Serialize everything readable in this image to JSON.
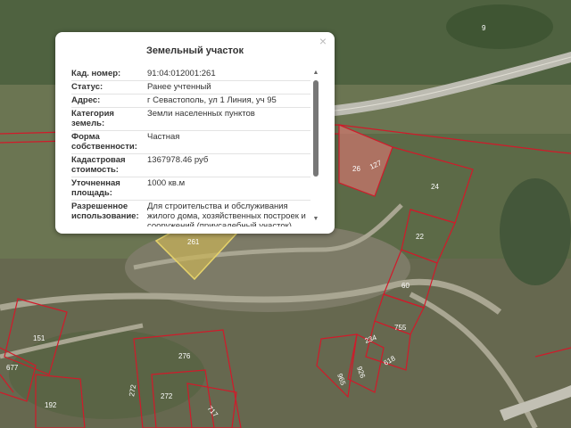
{
  "popup": {
    "title": "Земельный участок",
    "close_glyph": "×",
    "rows": [
      {
        "key": "Кад. номер:",
        "value": "91:04:012001:261"
      },
      {
        "key": "Статус:",
        "value": "Ранее учтенный"
      },
      {
        "key": "Адрес:",
        "value": "г Севастополь, ул 1 Линия, уч 95"
      },
      {
        "key": "Категория земель:",
        "value": "Земли населенных пунктов"
      },
      {
        "key": "Форма собственности:",
        "value": "Частная"
      },
      {
        "key": "Кадастровая стоимость:",
        "value": "1367978.46 руб"
      },
      {
        "key": "Уточненная площадь:",
        "value": "1000 кв.м"
      },
      {
        "key": "Разрешенное использование:",
        "value": "Для строительства и обслуживания жилого дома, хозяйственных построек и сооружений (приусадебный участок)"
      }
    ],
    "scroll_up_glyph": "▲",
    "scroll_down_glyph": "▼"
  },
  "map": {
    "colors": {
      "parcel_border": "#d11a2a",
      "selected_fill": "#c9b458",
      "road": "#c2c0b4",
      "vegetation": "#4b5e38",
      "ground": "#8c8a78"
    },
    "labels": {
      "p9": "9",
      "p26": "26",
      "p127": "127",
      "p24": "24",
      "p22": "22",
      "p60": "60",
      "p755": "755",
      "p234": "234",
      "p618": "618",
      "p926": "926",
      "p965": "965",
      "p276": "276",
      "p272a": "272",
      "p272b": "272",
      "p151": "151",
      "p677": "677",
      "p192": "192",
      "p717": "717",
      "p261": "261"
    }
  }
}
